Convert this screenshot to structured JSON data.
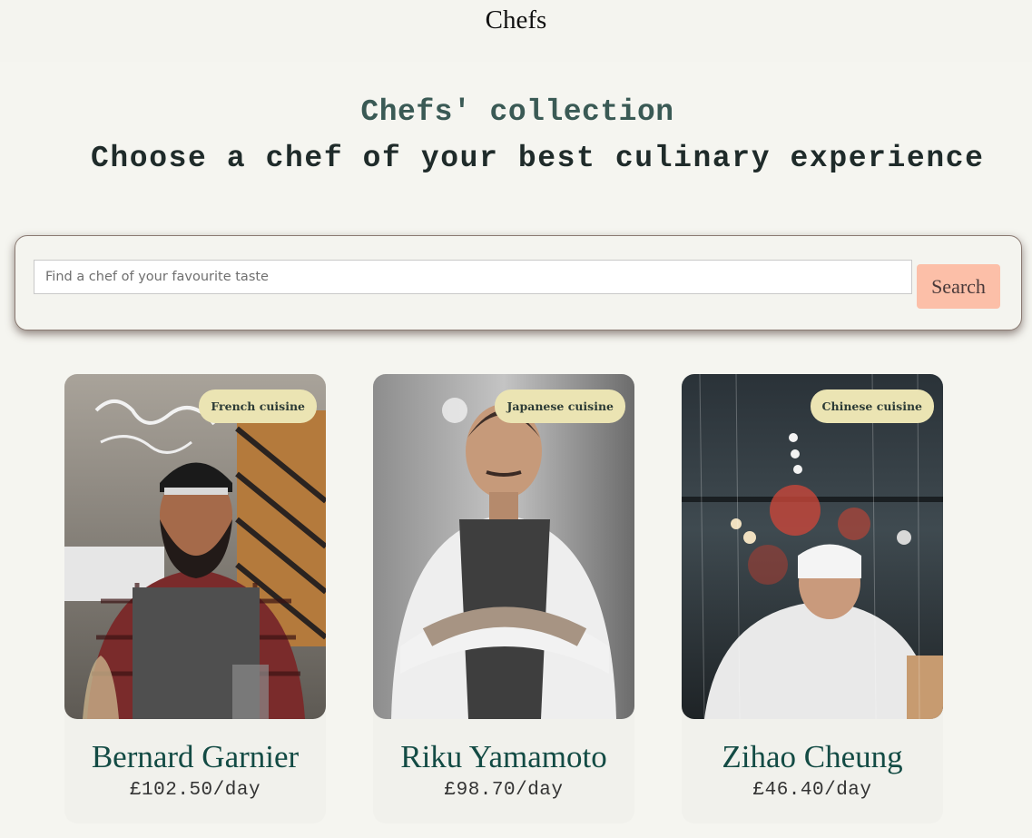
{
  "header": {
    "brand": "Chefs"
  },
  "hero": {
    "title": "Chefs' collection",
    "subtitle": "Choose a chef of your best culinary experience"
  },
  "search": {
    "placeholder": "Find a chef of your favourite taste",
    "value": "",
    "button_label": "Search"
  },
  "chefs": [
    {
      "name": "Bernard Garnier",
      "price": "£102.50/day",
      "cuisine": "French cuisine"
    },
    {
      "name": "Riku Yamamoto",
      "price": "£98.70/day",
      "cuisine": "Japanese cuisine"
    },
    {
      "name": "Zihao Cheung",
      "price": "£46.40/day",
      "cuisine": "Chinese cuisine"
    }
  ],
  "colors": {
    "background": "#f5f5f0",
    "accent_button": "#fcbfa8",
    "badge": "#ebe4b3",
    "name_text": "#134b44"
  }
}
